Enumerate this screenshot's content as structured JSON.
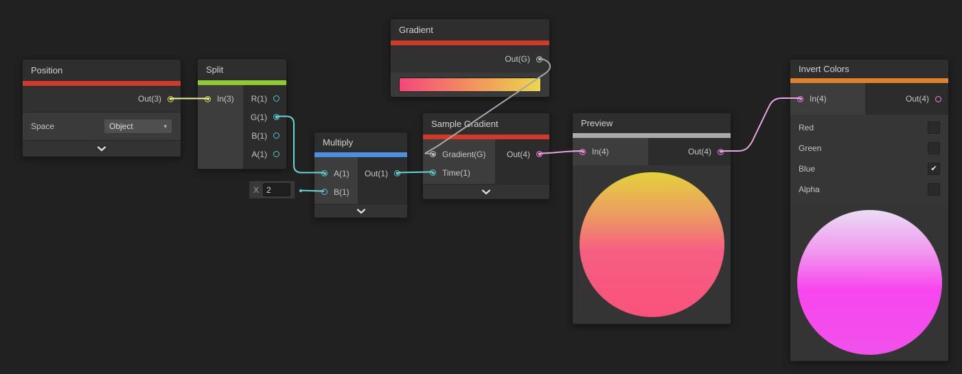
{
  "graph": {
    "background": "#212121"
  },
  "icons": {
    "dropdown_arrow": "▾",
    "checkmark": "✔"
  },
  "port_colors": {
    "vector1": "#58c6cd",
    "vector3": "#dfe65c",
    "vector4": "#ee86e6",
    "gradient": "#c9c9c9"
  },
  "accent_colors": {
    "red": "#d13a2a",
    "green": "#90c931",
    "blue": "#4b8fe2",
    "gray": "#ababab",
    "orange": "#e2812c"
  },
  "nodes": {
    "position": {
      "title": "Position",
      "out_label": "Out(3)",
      "space_label": "Space",
      "space_value": "Object"
    },
    "split": {
      "title": "Split",
      "in_label": "In(3)",
      "out_labels": [
        "R(1)",
        "G(1)",
        "B(1)",
        "A(1)"
      ]
    },
    "gradient": {
      "title": "Gradient",
      "out_label": "Out(G)",
      "strip_gradient": "90deg, #f5477b 0%, #f2975d 55%, #ecd74b 100%"
    },
    "multiply": {
      "title": "Multiply",
      "in_a_label": "A(1)",
      "in_b_label": "B(1)",
      "out_label": "Out(1)",
      "x_label": "X",
      "x_value": "2"
    },
    "sample_gradient": {
      "title": "Sample Gradient",
      "in_gradient_label": "Gradient(G)",
      "in_time_label": "Time(1)",
      "out_label": "Out(4)"
    },
    "preview": {
      "title": "Preview",
      "in_label": "In(4)",
      "out_label": "Out(4)",
      "sphere_gradient": "180deg, #e2d23b 0%, #ec9a62 30%, #f75d82 55%, #fa527c 100%"
    },
    "invert_colors": {
      "title": "Invert Colors",
      "in_label": "In(4)",
      "out_label": "Out(4)",
      "channels": [
        {
          "label": "Red",
          "checked": false
        },
        {
          "label": "Green",
          "checked": false
        },
        {
          "label": "Blue",
          "checked": true
        },
        {
          "label": "Alpha",
          "checked": false
        }
      ],
      "sphere_gradient": "180deg, #eadcf5 0%, #f294ee 30%, #f846ee 55%, #f051eb 100%"
    }
  }
}
